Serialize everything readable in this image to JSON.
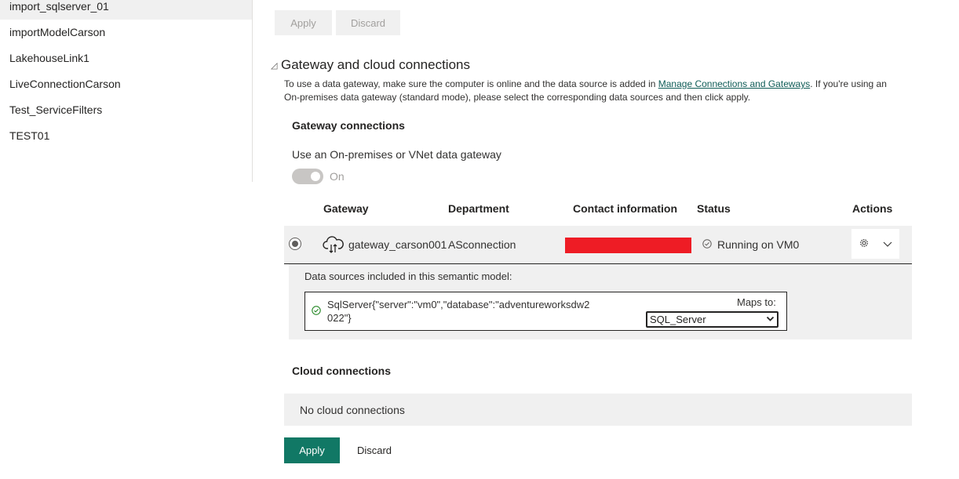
{
  "sidebar": {
    "items": [
      {
        "label": "import_sqlserver_01",
        "selected": true
      },
      {
        "label": "importModelCarson"
      },
      {
        "label": "LakehouseLink1"
      },
      {
        "label": "LiveConnectionCarson"
      },
      {
        "label": "Test_ServiceFilters"
      },
      {
        "label": "TEST01"
      }
    ]
  },
  "top_buttons": {
    "apply": "Apply",
    "discard": "Discard"
  },
  "section": {
    "title": "Gateway and cloud connections",
    "desc_before": "To use a data gateway, make sure the computer is online and the data source is added in ",
    "desc_link": "Manage Connections and Gateways",
    "desc_after": ". If you're using an On-premises data gateway (standard mode), please select the corresponding data sources and then click apply."
  },
  "gateway_connections": {
    "heading": "Gateway connections",
    "toggle_label": "Use an On-premises or VNet data gateway",
    "toggle_state": "On",
    "columns": [
      "Gateway",
      "Department",
      "Contact information",
      "Status",
      "Actions"
    ],
    "row": {
      "gateway": "gateway_carson001",
      "department": "ASconnection",
      "status": "Running on VM0"
    },
    "datasources": {
      "caption": "Data sources included in this semantic model:",
      "name": "SqlServer{\"server\":\"vm0\",\"database\":\"adventureworksdw2022\"}",
      "maps_to_label": "Maps to:",
      "maps_to_value": "SQL_Server"
    }
  },
  "cloud_connections": {
    "heading": "Cloud connections",
    "empty_text": "No cloud connections"
  },
  "bottom_buttons": {
    "apply": "Apply",
    "discard": "Discard"
  },
  "colors": {
    "accent": "#117865",
    "link": "#0f5c57",
    "redaction": "#ee1c25"
  },
  "icons": [
    "gateway-cloud-icon",
    "status-check-icon",
    "datasource-check-icon",
    "gear-icon",
    "chevron-down-icon",
    "collapse-triangle-icon"
  ]
}
